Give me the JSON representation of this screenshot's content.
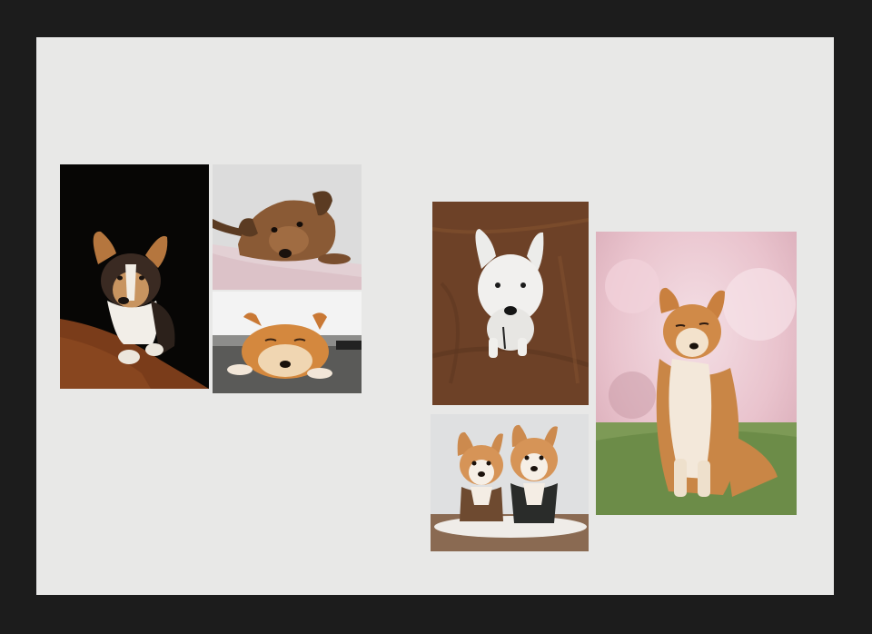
{
  "photos": [
    {
      "id": "p1",
      "icon": "corgi-puppy-dark-photo"
    },
    {
      "id": "p2",
      "icon": "brown-puppy-lying-photo"
    },
    {
      "id": "p3",
      "icon": "shiba-puppy-sleeping-photo"
    },
    {
      "id": "p4",
      "icon": "white-dog-brown-cloth-photo"
    },
    {
      "id": "p5",
      "icon": "two-corgis-sweaters-photo"
    },
    {
      "id": "p6",
      "icon": "shiba-sitting-cherry-blossom-photo"
    }
  ],
  "colors": {
    "frame": "#1c1c1c",
    "canvas": "#e8e8e7"
  }
}
